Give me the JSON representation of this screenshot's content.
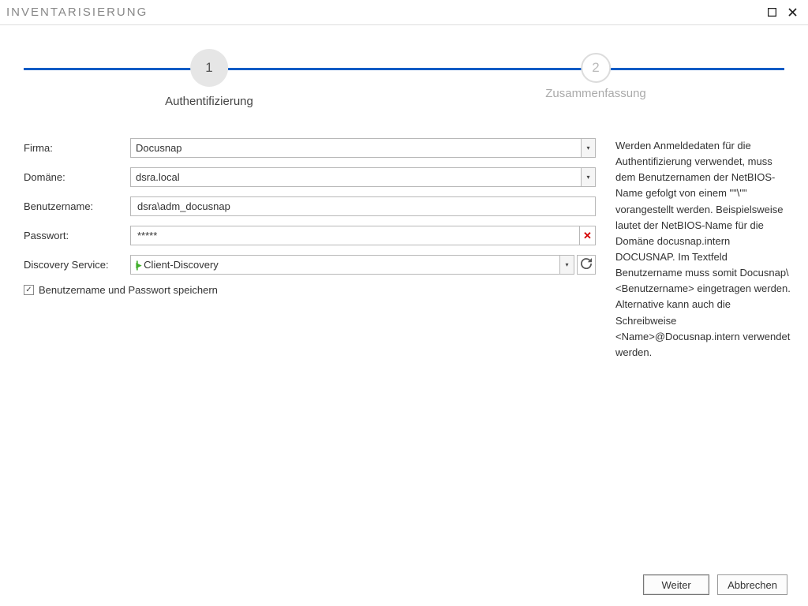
{
  "window": {
    "title": "INVENTARISIERUNG"
  },
  "wizard": {
    "step1": {
      "number": "1",
      "label": "Authentifizierung"
    },
    "step2": {
      "number": "2",
      "label": "Zusammenfassung"
    }
  },
  "form": {
    "company_label": "Firma:",
    "company_value": "Docusnap",
    "domain_label": "Domäne:",
    "domain_value": "dsra.local",
    "username_label": "Benutzername:",
    "username_value": "dsra\\adm_docusnap",
    "password_label": "Passwort:",
    "password_value": "*****",
    "discovery_label": "Discovery Service:",
    "discovery_value": "Client-Discovery",
    "save_creds_label": "Benutzername und Passwort speichern",
    "save_creds_checked": true
  },
  "help": {
    "text": "Werden Anmeldedaten für die Authentifizierung verwendet, muss dem Benutzernamen der NetBIOS-Name gefolgt von einem \"\"\\\"\" vorangestellt werden. Beispielsweise lautet der NetBIOS-Name für die Domäne docusnap.intern DOCUSNAP. Im Textfeld Benutzername muss somit Docusnap\\<Benutzername> eingetragen werden. Alternative kann auch die Schreibweise <Name>@Docusnap.intern verwendet werden."
  },
  "footer": {
    "next_label": "Weiter",
    "cancel_label": "Abbrechen"
  }
}
